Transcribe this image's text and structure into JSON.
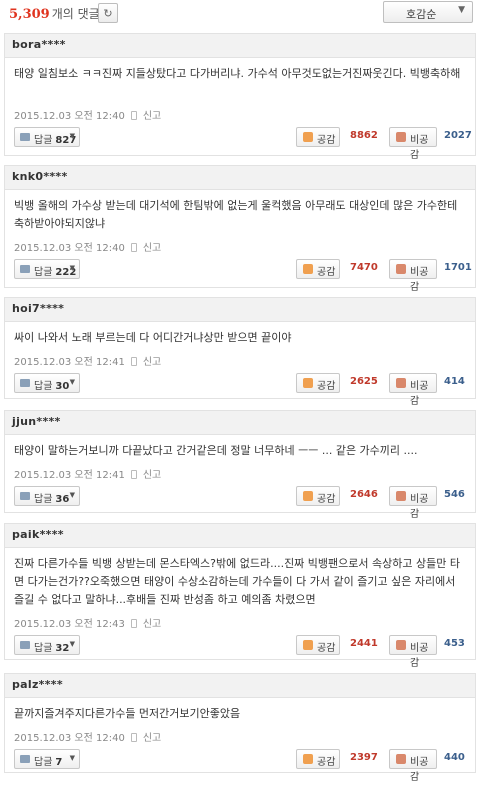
{
  "header": {
    "count": "5,309",
    "count_suffix": "개의 댓글",
    "refresh_icon": "↻",
    "sort_label": "호감순",
    "sort_caret": "▼"
  },
  "meta_icon": "mobile-phone-icon",
  "report_label": "신고",
  "reply_label": "답글",
  "like_label": "공감",
  "dislike_label": "비공감",
  "comments": [
    {
      "user": "bora****",
      "text": "태양 일침보소 ㅋㅋ진짜 지들상탔다고 다가버리냐. 가수석 아무것도없는거진짜웃긴다. 빅뱅축하해",
      "date": "2015.12.03 오전 12:40",
      "replies": "827",
      "likes": "8862",
      "dislikes": "2027"
    },
    {
      "user": "knk0****",
      "text": "빅뱅 올해의 가수상 받는데 대기석에 한팀밖에 없는게 울컥했음 아무래도 대상인데 많은 가수한테 축하받아야되지않냐",
      "date": "2015.12.03 오전 12:40",
      "replies": "222",
      "likes": "7470",
      "dislikes": "1701"
    },
    {
      "user": "hoi7****",
      "text": "싸이 나와서 노래 부르는데 다 어디간거냐상만 받으면 끝이야",
      "date": "2015.12.03 오전 12:41",
      "replies": "30",
      "likes": "2625",
      "dislikes": "414"
    },
    {
      "user": "jjun****",
      "text": "태양이 말하는거보니까 다끝났다고 간거같은데 정말 너무하네 ㅡㅡ ... 같은 가수끼리 ....",
      "date": "2015.12.03 오전 12:41",
      "replies": "36",
      "likes": "2646",
      "dislikes": "546"
    },
    {
      "user": "paik****",
      "text": "진짜 다른가수들 빅뱅 상받는데 몬스타엑스?밖에 없드라....진짜 빅뱅팬으로서 속상하고 상들만 타면 다가는건가??오죽했으면 태양이 수상소감하는데 가수들이 다 가서 같이 즐기고 싶은 자리에서 즐길 수 없다고 말하냐...후배들 진짜 반성좀 하고 예의좀 차렸으면",
      "date": "2015.12.03 오전 12:43",
      "replies": "32",
      "likes": "2441",
      "dislikes": "453"
    },
    {
      "user": "palz****",
      "text": "끝까지즐겨주지다른가수들 먼저간거보기안좋았음",
      "date": "2015.12.03 오전 12:40",
      "replies": "7",
      "likes": "2397",
      "dislikes": "440"
    }
  ]
}
